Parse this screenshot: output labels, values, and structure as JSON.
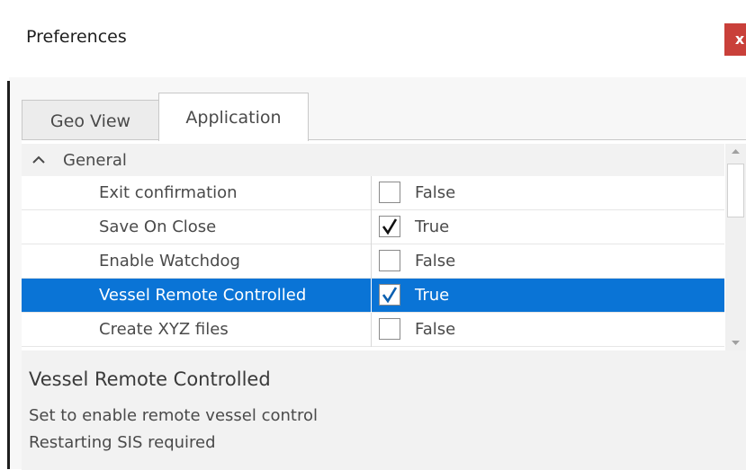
{
  "window": {
    "title": "Preferences",
    "close_label": "x"
  },
  "tabs": [
    {
      "label": "Geo View",
      "active": false
    },
    {
      "label": "Application",
      "active": true
    }
  ],
  "group": {
    "label": "General",
    "expanded": true
  },
  "rows": [
    {
      "name": "Exit confirmation",
      "checked": false,
      "value": "False",
      "selected": false
    },
    {
      "name": "Save On Close",
      "checked": true,
      "value": "True",
      "selected": false
    },
    {
      "name": "Enable Watchdog",
      "checked": false,
      "value": "False",
      "selected": false
    },
    {
      "name": "Vessel Remote Controlled",
      "checked": true,
      "value": "True",
      "selected": true
    },
    {
      "name": "Create XYZ files",
      "checked": false,
      "value": "False",
      "selected": false
    }
  ],
  "description": {
    "title": "Vessel Remote Controlled",
    "line1": "Set to enable remote vessel control",
    "line2": "Restarting SIS required"
  },
  "colors": {
    "selection": "#0a74d6",
    "close": "#c9403a"
  }
}
